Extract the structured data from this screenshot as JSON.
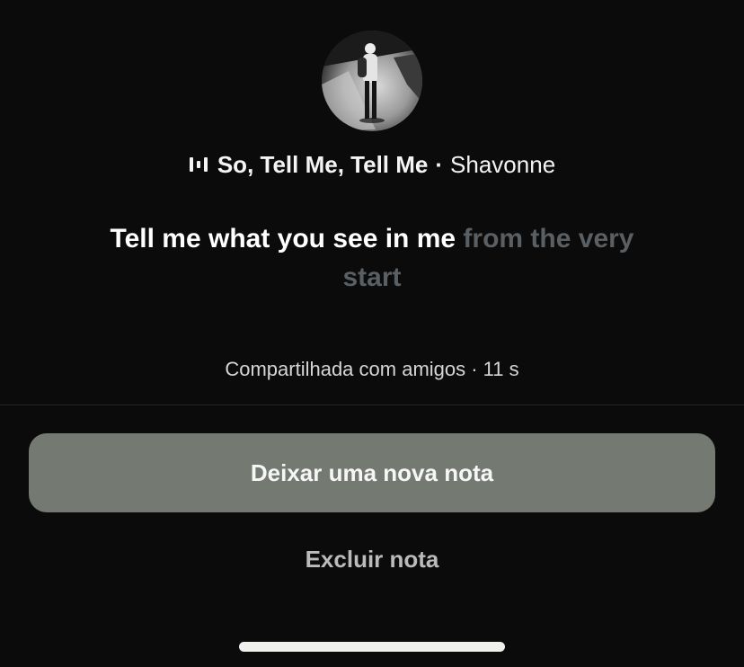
{
  "note": {
    "song_title": "So, Tell Me, Tell Me",
    "separator": "·",
    "artist": "Shavonne",
    "lyric_sung": "Tell me what you see in me",
    "lyric_upcoming": "from the very start",
    "meta": "Compartilhada com amigos · 11 s"
  },
  "actions": {
    "primary_label": "Deixar uma nova nota",
    "secondary_label": "Excluir nota"
  },
  "icons": {
    "music": "music-bars-icon"
  },
  "colors": {
    "background": "#0b0b0b",
    "primary_button": "#747a72",
    "lyric_upcoming": "#5a5f63",
    "secondary_text": "#b9bcb8"
  }
}
